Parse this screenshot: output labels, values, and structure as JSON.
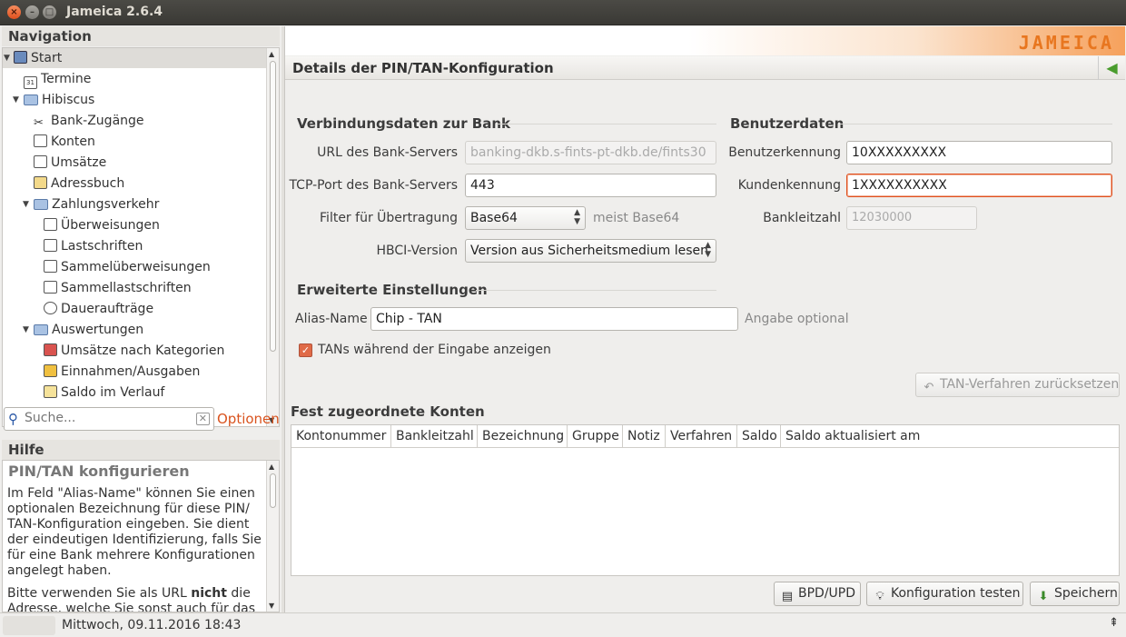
{
  "window": {
    "title": "Jameica 2.6.4"
  },
  "navigation": {
    "header": "Navigation",
    "items": [
      {
        "label": "Start",
        "icon": "computer-icon"
      },
      {
        "label": "Termine",
        "icon": "calendar-icon"
      },
      {
        "label": "Hibiscus",
        "icon": "folder-icon"
      },
      {
        "label": "Bank-Zugänge",
        "icon": "tools-icon"
      },
      {
        "label": "Konten",
        "icon": "account-icon"
      },
      {
        "label": "Umsätze",
        "icon": "transactions-icon"
      },
      {
        "label": "Adressbuch",
        "icon": "addressbook-icon"
      },
      {
        "label": "Zahlungsverkehr",
        "icon": "folder-icon"
      },
      {
        "label": "Überweisungen",
        "icon": "transfer-icon"
      },
      {
        "label": "Lastschriften",
        "icon": "debit-icon"
      },
      {
        "label": "Sammelüberweisungen",
        "icon": "batch-transfer-icon"
      },
      {
        "label": "Sammellastschriften",
        "icon": "batch-debit-icon"
      },
      {
        "label": "Daueraufträge",
        "icon": "clock-icon"
      },
      {
        "label": "Auswertungen",
        "icon": "folder-icon"
      },
      {
        "label": "Umsätze nach Kategorien",
        "icon": "pie-chart-icon"
      },
      {
        "label": "Einnahmen/Ausgaben",
        "icon": "money-icon"
      },
      {
        "label": "Saldo im Verlauf",
        "icon": "chart-icon"
      }
    ]
  },
  "search": {
    "placeholder": "Suche...",
    "options_label": "Optionen"
  },
  "help": {
    "header": "Hilfe",
    "title": "PIN/TAN konfigurieren",
    "para1": "Im Feld \"Alias-Name\" können Sie einen optionalen Bezeichnung für diese PIN/ TAN-Konfiguration eingeben. Sie dient der eindeutigen Identifizierung, falls Sie für eine Bank mehrere Konfigurationen angelegt haben.",
    "para2_a": "Bitte verwenden Sie als URL ",
    "para2_b": "nicht",
    "para2_c": " die Adresse, welche Sie sonst auch für das"
  },
  "banner": {
    "logo": "JAMEICA"
  },
  "page": {
    "title": "Details der PIN/TAN-Konfiguration"
  },
  "connection": {
    "header": "Verbindungsdaten zur Bank",
    "url_label": "URL des Bank-Servers",
    "url_value": "banking-dkb.s-fints-pt-dkb.de/fints30",
    "port_label": "TCP-Port des Bank-Servers",
    "port_value": "443",
    "filter_label": "Filter für Übertragung",
    "filter_value": "Base64",
    "filter_hint": "meist Base64",
    "hbci_label": "HBCI-Version",
    "hbci_value": "Version aus Sicherheitsmedium lesen"
  },
  "user": {
    "header": "Benutzerdaten",
    "userid_label": "Benutzerkennung",
    "userid_value": "10XXXXXXXXX",
    "customer_label": "Kundenkennung",
    "customer_value": "1XXXXXXXXXX",
    "blz_label": "Bankleitzahl",
    "blz_value": "12030000"
  },
  "advanced": {
    "header": "Erweiterte Einstellungen",
    "alias_label": "Alias-Name",
    "alias_value": "Chip - TAN",
    "alias_hint": "Angabe optional",
    "show_tan_label": "TANs während der Eingabe anzeigen",
    "show_tan_checked": true,
    "reset_button": "TAN-Verfahren zurücksetzen"
  },
  "accounts": {
    "header": "Fest zugeordnete Konten",
    "columns": [
      "Kontonummer",
      "Bankleitzahl",
      "Bezeichnung",
      "Gruppe",
      "Notiz",
      "Verfahren",
      "Saldo",
      "Saldo aktualisiert am"
    ]
  },
  "buttons": {
    "bpd": "BPD/UPD",
    "test": "Konfiguration testen",
    "save": "Speichern"
  },
  "statusbar": {
    "datetime": "Mittwoch, 09.11.2016 18:43"
  }
}
